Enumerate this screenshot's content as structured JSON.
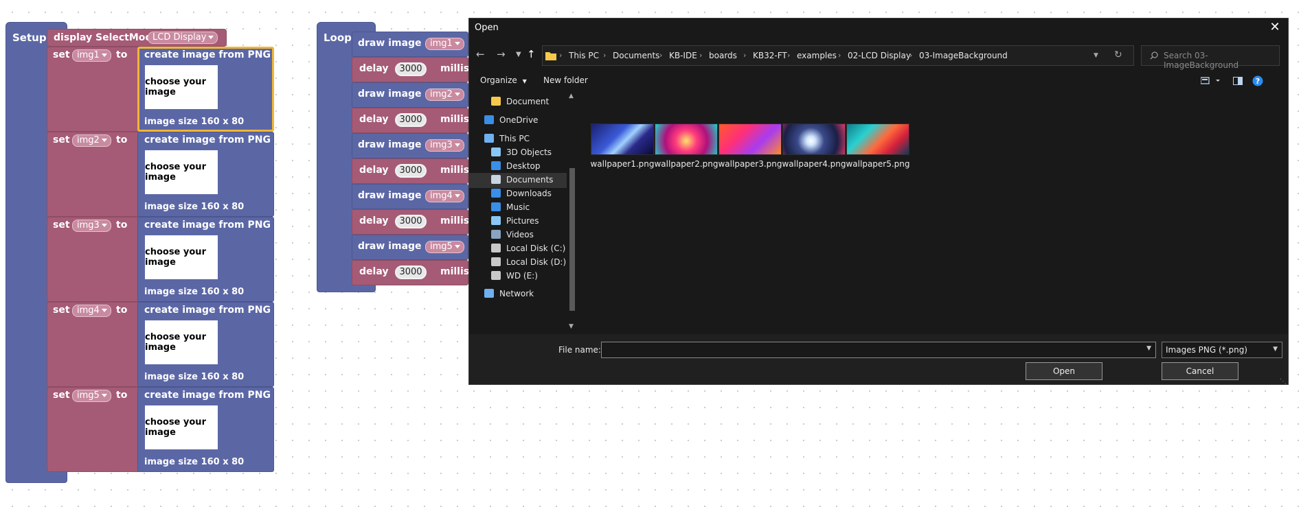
{
  "setup": {
    "hat_label": "Setup",
    "display_block": {
      "label": "display SelectMode",
      "mode": "LCD Display"
    },
    "rows": [
      {
        "set": "set",
        "var": "img1",
        "to": "to",
        "create": "create image from PNG file",
        "choose": "choose your image",
        "size": "image size 160 x 80"
      },
      {
        "set": "set",
        "var": "img2",
        "to": "to",
        "create": "create image from PNG file",
        "choose": "choose your image",
        "size": "image size 160 x 80"
      },
      {
        "set": "set",
        "var": "img3",
        "to": "to",
        "create": "create image from PNG file",
        "choose": "choose your image",
        "size": "image size 160 x 80"
      },
      {
        "set": "set",
        "var": "img4",
        "to": "to",
        "create": "create image from PNG file",
        "choose": "choose your image",
        "size": "image size 160 x 80"
      },
      {
        "set": "set",
        "var": "img5",
        "to": "to",
        "create": "create image from PNG file",
        "choose": "choose your image",
        "size": "image size 160 x 80"
      }
    ]
  },
  "loop": {
    "hat_label": "Loop",
    "steps": [
      {
        "kind": "draw",
        "label": "draw image",
        "var": "img1"
      },
      {
        "kind": "delay",
        "label": "delay",
        "value": "3000",
        "unit": "millise"
      },
      {
        "kind": "draw",
        "label": "draw image",
        "var": "img2"
      },
      {
        "kind": "delay",
        "label": "delay",
        "value": "3000",
        "unit": "millise"
      },
      {
        "kind": "draw",
        "label": "draw image",
        "var": "img3"
      },
      {
        "kind": "delay",
        "label": "delay",
        "value": "3000",
        "unit": "millise"
      },
      {
        "kind": "draw",
        "label": "draw image",
        "var": "img4"
      },
      {
        "kind": "delay",
        "label": "delay",
        "value": "3000",
        "unit": "millise"
      },
      {
        "kind": "draw",
        "label": "draw image",
        "var": "img5"
      },
      {
        "kind": "delay",
        "label": "delay",
        "value": "3000",
        "unit": "millise"
      }
    ]
  },
  "dialog": {
    "title": "Open",
    "close": "✕",
    "breadcrumb": [
      "This PC",
      "Documents",
      "KB-IDE",
      "boards",
      "KB32-FT",
      "examples",
      "02-LCD Display",
      "03-ImageBackground"
    ],
    "search_placeholder": "Search 03-ImageBackground",
    "toolbar": {
      "organize": "Organize",
      "new_folder": "New folder"
    },
    "nav_items": [
      {
        "label": "Document",
        "icon": "folder-icon"
      },
      {
        "label": "OneDrive",
        "icon": "cloud-icon"
      },
      {
        "label": "This PC",
        "icon": "computer-icon"
      },
      {
        "label": "3D Objects",
        "icon": "3d-objects-icon"
      },
      {
        "label": "Desktop",
        "icon": "desktop-icon"
      },
      {
        "label": "Documents",
        "icon": "documents-icon",
        "selected": true
      },
      {
        "label": "Downloads",
        "icon": "download-icon"
      },
      {
        "label": "Music",
        "icon": "music-icon"
      },
      {
        "label": "Pictures",
        "icon": "pictures-icon"
      },
      {
        "label": "Videos",
        "icon": "videos-icon"
      },
      {
        "label": "Local Disk (C:)",
        "icon": "drive-icon"
      },
      {
        "label": "Local Disk (D:)",
        "icon": "drive-icon"
      },
      {
        "label": "WD (E:)",
        "icon": "drive-icon"
      },
      {
        "label": "Network",
        "icon": "network-icon"
      }
    ],
    "files": [
      {
        "name": "wallpaper1.png"
      },
      {
        "name": "wallpaper2.png"
      },
      {
        "name": "wallpaper3.png"
      },
      {
        "name": "wallpaper4.png"
      },
      {
        "name": "wallpaper5.png"
      }
    ],
    "file_name_label": "File name:",
    "file_name_value": "",
    "file_type": "Images PNG (*.png)",
    "open_button": "Open",
    "cancel_button": "Cancel"
  },
  "colors": {
    "block_blue": "#5b67a5",
    "block_red": "#a55b75",
    "selection_highlight": "#f2b632",
    "dialog_bg": "#191919"
  }
}
